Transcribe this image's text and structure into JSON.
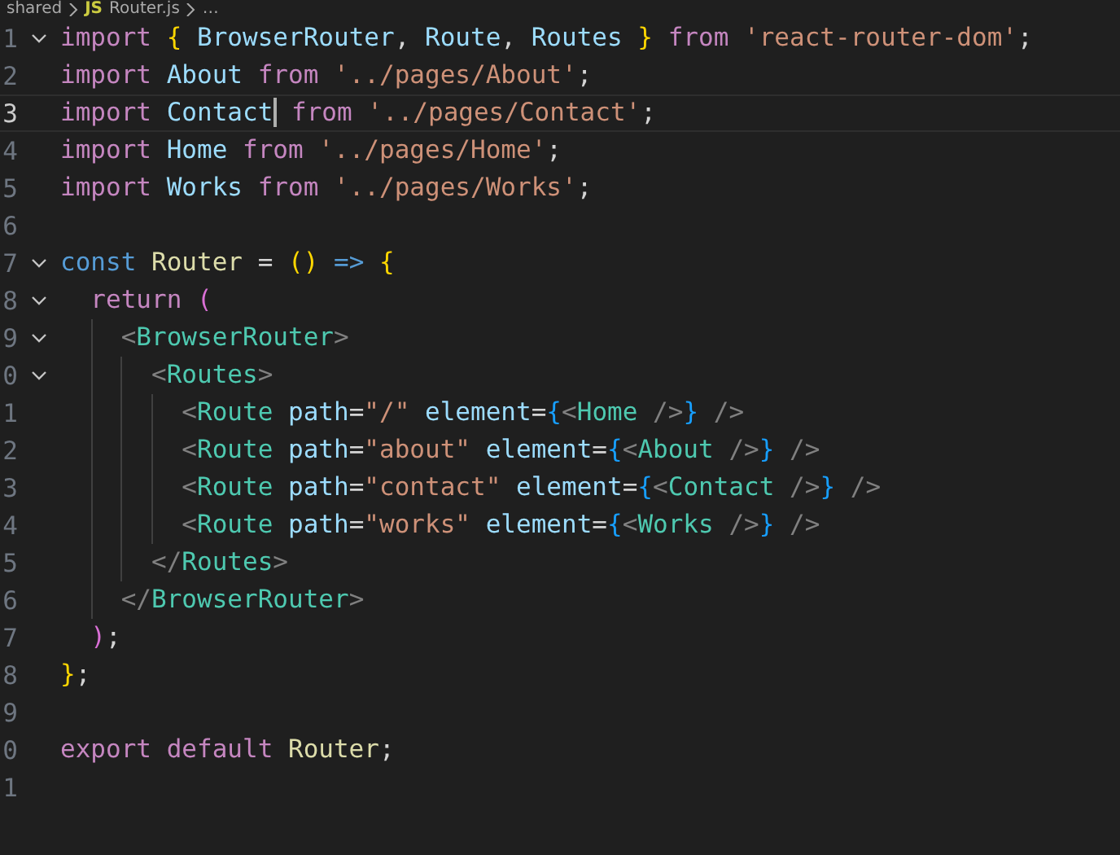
{
  "breadcrumb": [
    {
      "text": "shared"
    },
    {
      "text": "Router.js",
      "badge": "JS"
    },
    {
      "text": "…"
    }
  ],
  "lines": [
    {
      "number": "1",
      "foldable": true,
      "current": false,
      "tokens": [
        {
          "text": "import ",
          "kind": "kw"
        },
        {
          "text": "{ ",
          "kind": "b1"
        },
        {
          "text": "BrowserRouter",
          "kind": "var"
        },
        {
          "text": ", ",
          "kind": "punct"
        },
        {
          "text": "Route",
          "kind": "var"
        },
        {
          "text": ", ",
          "kind": "punct"
        },
        {
          "text": "Routes ",
          "kind": "var"
        },
        {
          "text": "} ",
          "kind": "b1"
        },
        {
          "text": "from ",
          "kind": "kw"
        },
        {
          "text": "'react-router-dom'",
          "kind": "str"
        },
        {
          "text": ";",
          "kind": "punct"
        }
      ]
    },
    {
      "number": "2",
      "foldable": false,
      "current": false,
      "tokens": [
        {
          "text": "import ",
          "kind": "kw"
        },
        {
          "text": "About ",
          "kind": "var"
        },
        {
          "text": "from ",
          "kind": "kw"
        },
        {
          "text": "'../pages/About'",
          "kind": "str"
        },
        {
          "text": ";",
          "kind": "punct"
        }
      ]
    },
    {
      "number": "3",
      "foldable": false,
      "current": true,
      "tokens": [
        {
          "text": "import ",
          "kind": "kw"
        },
        {
          "text": "Contact",
          "kind": "var",
          "cursor": true
        },
        {
          "text": " from ",
          "kind": "kw"
        },
        {
          "text": "'../pages/Contact'",
          "kind": "str"
        },
        {
          "text": ";",
          "kind": "punct"
        }
      ]
    },
    {
      "number": "4",
      "foldable": false,
      "current": false,
      "tokens": [
        {
          "text": "import ",
          "kind": "kw"
        },
        {
          "text": "Home ",
          "kind": "var"
        },
        {
          "text": "from ",
          "kind": "kw"
        },
        {
          "text": "'../pages/Home'",
          "kind": "str"
        },
        {
          "text": ";",
          "kind": "punct"
        }
      ]
    },
    {
      "number": "5",
      "foldable": false,
      "current": false,
      "tokens": [
        {
          "text": "import ",
          "kind": "kw"
        },
        {
          "text": "Works ",
          "kind": "var"
        },
        {
          "text": "from ",
          "kind": "kw"
        },
        {
          "text": "'../pages/Works'",
          "kind": "str"
        },
        {
          "text": ";",
          "kind": "punct"
        }
      ]
    },
    {
      "number": "6",
      "foldable": false,
      "current": false
    },
    {
      "number": "7",
      "foldable": true,
      "current": false,
      "tokens": [
        {
          "text": "const ",
          "kind": "storage"
        },
        {
          "text": "Router ",
          "kind": "fn"
        },
        {
          "text": "= ",
          "kind": "punct"
        },
        {
          "text": "() ",
          "kind": "b1"
        },
        {
          "text": "=> ",
          "kind": "storage"
        },
        {
          "text": "{",
          "kind": "b1"
        }
      ]
    },
    {
      "number": "8",
      "foldable": true,
      "current": false,
      "tokens": [
        {
          "text": "  return ",
          "kind": "kw"
        },
        {
          "text": "(",
          "kind": "b2"
        }
      ]
    },
    {
      "number": "9",
      "foldable": true,
      "current": false,
      "tokens": [
        {
          "text": "    <",
          "kind": "tb"
        },
        {
          "text": "BrowserRouter",
          "kind": "tag"
        },
        {
          "text": ">",
          "kind": "tb"
        }
      ]
    },
    {
      "number": "0",
      "foldable": true,
      "current": false,
      "tokens": [
        {
          "text": "      <",
          "kind": "tb"
        },
        {
          "text": "Routes",
          "kind": "tag"
        },
        {
          "text": ">",
          "kind": "tb"
        }
      ]
    },
    {
      "number": "1",
      "foldable": false,
      "current": false,
      "tokens": [
        {
          "text": "        <",
          "kind": "tb"
        },
        {
          "text": "Route ",
          "kind": "tag"
        },
        {
          "text": "path",
          "kind": "attr"
        },
        {
          "text": "=",
          "kind": "punct"
        },
        {
          "text": "\"/\" ",
          "kind": "str"
        },
        {
          "text": "element",
          "kind": "attr"
        },
        {
          "text": "=",
          "kind": "punct"
        },
        {
          "text": "{",
          "kind": "b3"
        },
        {
          "text": "<",
          "kind": "tb"
        },
        {
          "text": "Home",
          "kind": "tag"
        },
        {
          "text": " />",
          "kind": "tb"
        },
        {
          "text": "}",
          "kind": "b3"
        },
        {
          "text": " />",
          "kind": "tb"
        }
      ]
    },
    {
      "number": "2",
      "foldable": false,
      "current": false,
      "tokens": [
        {
          "text": "        <",
          "kind": "tb"
        },
        {
          "text": "Route ",
          "kind": "tag"
        },
        {
          "text": "path",
          "kind": "attr"
        },
        {
          "text": "=",
          "kind": "punct"
        },
        {
          "text": "\"about\" ",
          "kind": "str"
        },
        {
          "text": "element",
          "kind": "attr"
        },
        {
          "text": "=",
          "kind": "punct"
        },
        {
          "text": "{",
          "kind": "b3"
        },
        {
          "text": "<",
          "kind": "tb"
        },
        {
          "text": "About",
          "kind": "tag"
        },
        {
          "text": " />",
          "kind": "tb"
        },
        {
          "text": "}",
          "kind": "b3"
        },
        {
          "text": " />",
          "kind": "tb"
        }
      ]
    },
    {
      "number": "3",
      "foldable": false,
      "current": false,
      "tokens": [
        {
          "text": "        <",
          "kind": "tb"
        },
        {
          "text": "Route ",
          "kind": "tag"
        },
        {
          "text": "path",
          "kind": "attr"
        },
        {
          "text": "=",
          "kind": "punct"
        },
        {
          "text": "\"contact\" ",
          "kind": "str"
        },
        {
          "text": "element",
          "kind": "attr"
        },
        {
          "text": "=",
          "kind": "punct"
        },
        {
          "text": "{",
          "kind": "b3"
        },
        {
          "text": "<",
          "kind": "tb"
        },
        {
          "text": "Contact",
          "kind": "tag"
        },
        {
          "text": " />",
          "kind": "tb"
        },
        {
          "text": "}",
          "kind": "b3"
        },
        {
          "text": " />",
          "kind": "tb"
        }
      ]
    },
    {
      "number": "4",
      "foldable": false,
      "current": false,
      "tokens": [
        {
          "text": "        <",
          "kind": "tb"
        },
        {
          "text": "Route ",
          "kind": "tag"
        },
        {
          "text": "path",
          "kind": "attr"
        },
        {
          "text": "=",
          "kind": "punct"
        },
        {
          "text": "\"works\" ",
          "kind": "str"
        },
        {
          "text": "element",
          "kind": "attr"
        },
        {
          "text": "=",
          "kind": "punct"
        },
        {
          "text": "{",
          "kind": "b3"
        },
        {
          "text": "<",
          "kind": "tb"
        },
        {
          "text": "Works",
          "kind": "tag"
        },
        {
          "text": " />",
          "kind": "tb"
        },
        {
          "text": "}",
          "kind": "b3"
        },
        {
          "text": " />",
          "kind": "tb"
        }
      ]
    },
    {
      "number": "5",
      "foldable": false,
      "current": false,
      "tokens": [
        {
          "text": "      </",
          "kind": "tb"
        },
        {
          "text": "Routes",
          "kind": "tag"
        },
        {
          "text": ">",
          "kind": "tb"
        }
      ]
    },
    {
      "number": "6",
      "foldable": false,
      "current": false,
      "tokens": [
        {
          "text": "    </",
          "kind": "tb"
        },
        {
          "text": "BrowserRouter",
          "kind": "tag"
        },
        {
          "text": ">",
          "kind": "tb"
        }
      ]
    },
    {
      "number": "7",
      "foldable": false,
      "current": false,
      "tokens": [
        {
          "text": "  )",
          "kind": "b2"
        },
        {
          "text": ";",
          "kind": "punct"
        }
      ]
    },
    {
      "number": "8",
      "foldable": false,
      "current": false,
      "tokens": [
        {
          "text": "}",
          "kind": "b1"
        },
        {
          "text": ";",
          "kind": "punct"
        }
      ]
    },
    {
      "number": "9",
      "foldable": false,
      "current": false
    },
    {
      "number": "0",
      "foldable": false,
      "current": false,
      "tokens": [
        {
          "text": "export default ",
          "kind": "kw"
        },
        {
          "text": "Router",
          "kind": "fn"
        },
        {
          "text": ";",
          "kind": "punct"
        }
      ]
    },
    {
      "number": "1",
      "foldable": false,
      "current": false
    }
  ]
}
